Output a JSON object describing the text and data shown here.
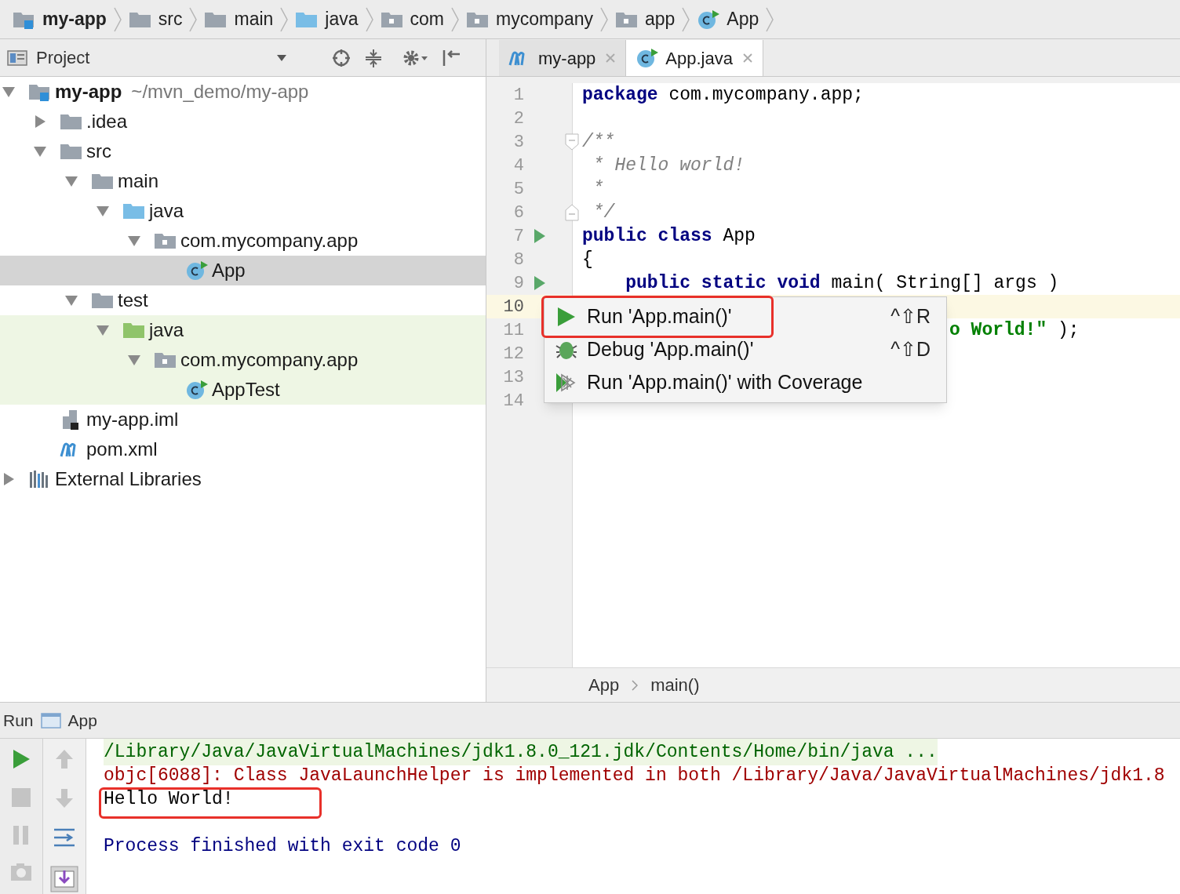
{
  "breadcrumbs": [
    {
      "label": "my-app",
      "kind": "module",
      "bold": true
    },
    {
      "label": "src",
      "kind": "folder",
      "bold": false
    },
    {
      "label": "main",
      "kind": "folder",
      "bold": false
    },
    {
      "label": "java",
      "kind": "source",
      "bold": false
    },
    {
      "label": "com",
      "kind": "package",
      "bold": false
    },
    {
      "label": "mycompany",
      "kind": "package",
      "bold": false
    },
    {
      "label": "app",
      "kind": "package",
      "bold": false
    },
    {
      "label": "App",
      "kind": "class",
      "bold": false
    }
  ],
  "project_panel": {
    "view": "Project"
  },
  "tabs": [
    {
      "label": "my-app",
      "kind": "maven",
      "selected": false
    },
    {
      "label": "App.java",
      "kind": "class",
      "selected": true
    }
  ],
  "tree": [
    {
      "label": "my-app",
      "path": "~/mvn_demo/my-app",
      "kind": "module",
      "expanded": true,
      "selected": false,
      "test": false,
      "children": [
        {
          "label": ".idea",
          "kind": "folder",
          "expanded": false,
          "selected": false,
          "test": false
        },
        {
          "label": "src",
          "kind": "folder",
          "expanded": true,
          "selected": false,
          "test": false,
          "children": [
            {
              "label": "main",
              "kind": "folder",
              "expanded": true,
              "selected": false,
              "test": false,
              "children": [
                {
                  "label": "java",
                  "kind": "source",
                  "expanded": true,
                  "selected": false,
                  "test": false,
                  "children": [
                    {
                      "label": "com.mycompany.app",
                      "kind": "package",
                      "expanded": true,
                      "selected": false,
                      "test": false,
                      "children": [
                        {
                          "label": "App",
                          "kind": "class",
                          "selected": true,
                          "test": false
                        }
                      ]
                    }
                  ]
                }
              ]
            },
            {
              "label": "test",
              "kind": "folder",
              "expanded": true,
              "selected": false,
              "test": false,
              "children": [
                {
                  "label": "java",
                  "kind": "testsource",
                  "expanded": true,
                  "selected": false,
                  "test": true,
                  "children": [
                    {
                      "label": "com.mycompany.app",
                      "kind": "package",
                      "expanded": true,
                      "selected": false,
                      "test": true,
                      "children": [
                        {
                          "label": "AppTest",
                          "kind": "class",
                          "selected": false,
                          "test": true
                        }
                      ]
                    }
                  ]
                }
              ]
            }
          ]
        },
        {
          "label": "my-app.iml",
          "kind": "iml",
          "selected": false,
          "test": false
        },
        {
          "label": "pom.xml",
          "kind": "maven",
          "selected": false,
          "test": false
        }
      ]
    },
    {
      "label": "External Libraries",
      "kind": "libraries",
      "expanded": false,
      "selected": false,
      "test": false
    }
  ],
  "editor": {
    "lines": [
      {
        "number": "1",
        "kind": "plain",
        "current": false,
        "segments": [
          {
            "kind": "keyword",
            "text": "package"
          },
          {
            "kind": "plain",
            "text": " com.mycompany.app;"
          }
        ]
      },
      {
        "number": "2",
        "kind": "plain",
        "current": false
      },
      {
        "number": "3",
        "kind": "opener",
        "current": false,
        "segments": [
          {
            "kind": "comment",
            "text": "/**"
          }
        ]
      },
      {
        "number": "4",
        "kind": "plain",
        "current": false,
        "segments": [
          {
            "kind": "comment",
            "text": " * Hello world!"
          }
        ]
      },
      {
        "number": "5",
        "kind": "plain",
        "current": false,
        "segments": [
          {
            "kind": "comment",
            "text": " *"
          }
        ]
      },
      {
        "number": "6",
        "kind": "closer",
        "current": false,
        "segments": [
          {
            "kind": "comment",
            "text": " */"
          }
        ]
      },
      {
        "number": "7",
        "kind": "runnable",
        "current": false,
        "segments": [
          {
            "kind": "keyword",
            "text": "public class"
          },
          {
            "kind": "plain",
            "text": " App"
          }
        ]
      },
      {
        "number": "8",
        "kind": "plain",
        "current": false,
        "segments": [
          {
            "kind": "plain",
            "text": "{"
          }
        ]
      },
      {
        "number": "9",
        "kind": "runnable",
        "current": false,
        "segments": [
          {
            "kind": "keyword",
            "text": "    public static void"
          },
          {
            "kind": "plain",
            "text": " main( String[] args )"
          }
        ]
      },
      {
        "number": "10",
        "kind": "plain",
        "current": true
      },
      {
        "number": "11",
        "kind": "covered",
        "current": false,
        "segments": [
          {
            "kind": "string",
            "text": "o World!\""
          },
          {
            "kind": "plain",
            "text": " );"
          }
        ]
      },
      {
        "number": "12",
        "kind": "plain",
        "current": false
      },
      {
        "number": "13",
        "kind": "plain",
        "current": false
      },
      {
        "number": "14",
        "kind": "plain",
        "current": false
      }
    ],
    "breadcrumbs": [
      "App",
      "main()"
    ]
  },
  "popup": [
    {
      "kind": "run",
      "label": "Run 'App.main()'",
      "shortcut": "^⇧R",
      "marked": true
    },
    {
      "kind": "debug",
      "label": "Debug 'App.main()'",
      "shortcut": "^⇧D",
      "marked": false
    },
    {
      "kind": "coverage",
      "label": "Run 'App.main()' with Coverage",
      "marked": false
    }
  ],
  "run_panel": {
    "title": "Run",
    "config": "App",
    "console": [
      {
        "kind": "command",
        "text": "/Library/Java/JavaVirtualMachines/jdk1.8.0_121.jdk/Contents/Home/bin/java ...",
        "marked": false
      },
      {
        "kind": "error",
        "text": "objc[6088]: Class JavaLaunchHelper is implemented in both /Library/Java/JavaVirtualMachines/jdk1.8",
        "marked": false
      },
      {
        "kind": "output",
        "text": "Hello World!",
        "marked": true
      },
      {
        "kind": "system",
        "text": "Process finished with exit code 0",
        "marked": false
      }
    ]
  }
}
